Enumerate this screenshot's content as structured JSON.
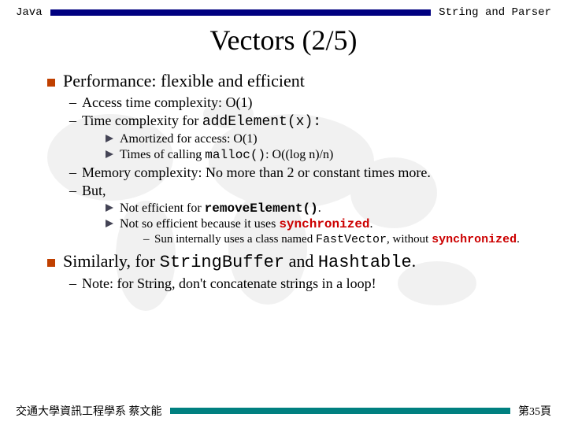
{
  "header": {
    "left": "Java",
    "right": "String and Parser"
  },
  "title": "Vectors (2/5)",
  "points": {
    "p1": "Performance: flexible and efficient",
    "p1a": "Access time complexity: O(1)",
    "p1b_pre": "Time complexity for ",
    "p1b_code": "addElement(x):",
    "p1b_i": "Amortized for access: O(1)",
    "p1b_ii_pre": "Times of calling ",
    "p1b_ii_code": "malloc()",
    "p1b_ii_post": ": O((log n)/n)",
    "p1c": "Memory complexity: No more than 2 or constant times more.",
    "p1d": "But,",
    "p1d_i_pre": "Not efficient for ",
    "p1d_i_code": "removeElement()",
    "p1d_i_post": ".",
    "p1d_ii_pre": "Not so efficient because it uses ",
    "p1d_ii_code": "synchronized",
    "p1d_ii_post": ".",
    "p1d_ii_sun_pre": "Sun internally uses a class named ",
    "p1d_ii_sun_code": "FastVector",
    "p1d_ii_sun_mid": ", without ",
    "p1d_ii_sun_code2": "synchronized",
    "p1d_ii_sun_post": ".",
    "p2_pre": "Similarly, for ",
    "p2_code1": "StringBuffer",
    "p2_mid": " and ",
    "p2_code2": "Hashtable",
    "p2_post": ".",
    "p2a": "Note: for String, don't concatenate strings in a loop!"
  },
  "footer": {
    "left": "交通大學資訊工程學系 蔡文能",
    "right": "第35頁"
  }
}
